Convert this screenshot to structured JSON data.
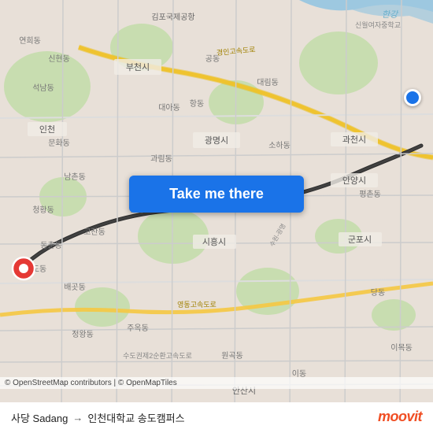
{
  "map": {
    "background_color": "#e8e0d8",
    "route_line_color": "#333333",
    "origin_label": "사당 Sadang",
    "destination_label": "인천대학교 송도캠퍼스",
    "arrow": "→"
  },
  "button": {
    "label": "Take me there"
  },
  "attribution": {
    "text": "© OpenStreetMap contributors | © OpenMapTiles"
  },
  "logo": {
    "text": "moovit"
  }
}
